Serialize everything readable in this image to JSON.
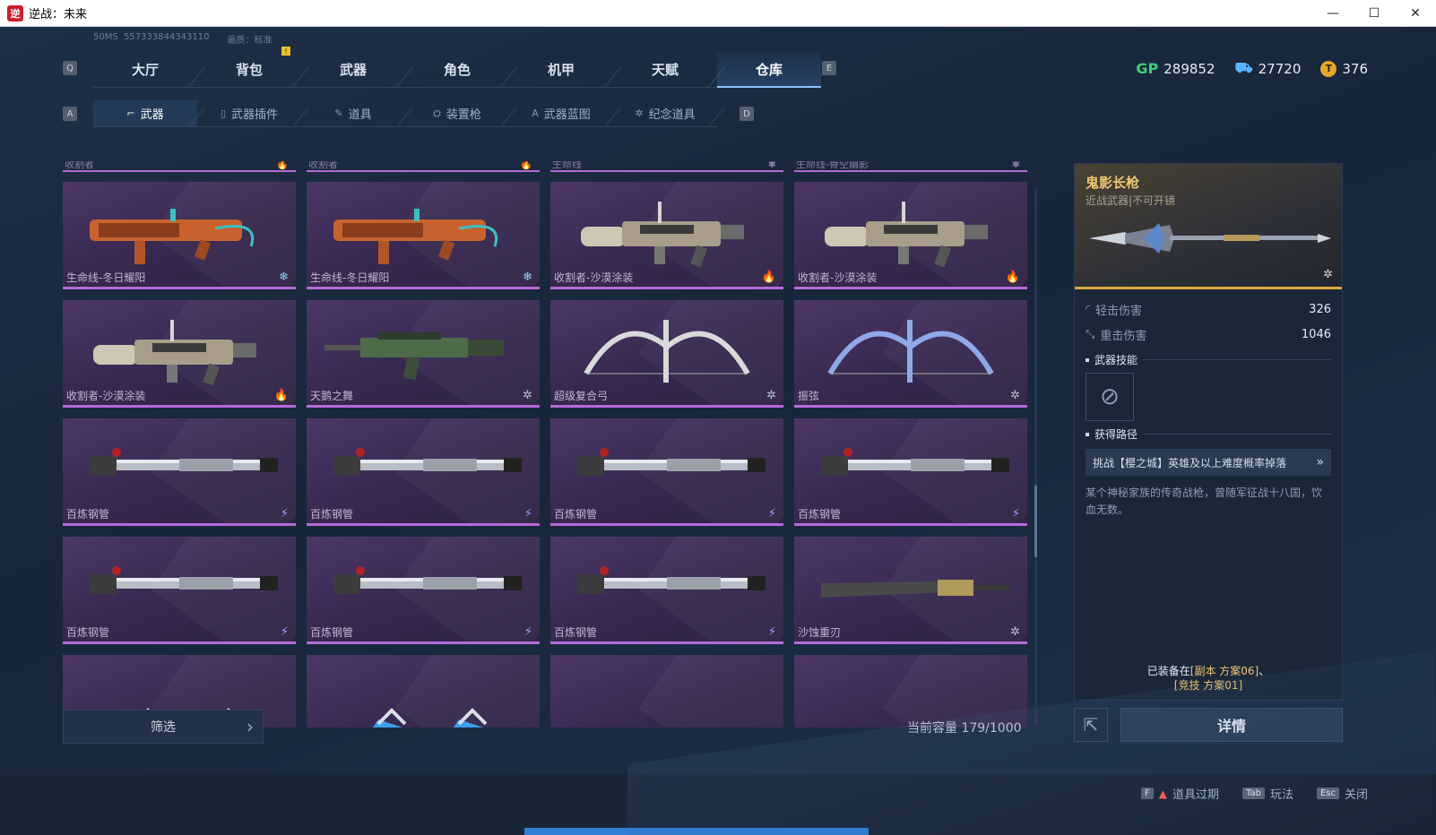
{
  "window": {
    "title": "逆战：未来",
    "controls": [
      "—",
      "☐",
      "✕"
    ]
  },
  "meta": {
    "ping": "50MS",
    "id": "557333844343110",
    "quality": "画质：标准"
  },
  "keys": {
    "prev_tab": "Q",
    "next_tab": "E",
    "prev_sub": "A",
    "next_sub": "D"
  },
  "main_tabs": [
    {
      "label": "大厅"
    },
    {
      "label": "背包"
    },
    {
      "label": "武器"
    },
    {
      "label": "角色"
    },
    {
      "label": "机甲"
    },
    {
      "label": "天赋"
    },
    {
      "label": "仓库"
    }
  ],
  "active_main_tab": "仓库",
  "badge": "!",
  "currency": [
    {
      "icon": "gp-icon",
      "symbol": "GP",
      "value": "289852"
    },
    {
      "icon": "ticket-icon",
      "symbol": "⛟",
      "value": "27720"
    },
    {
      "icon": "coin-icon",
      "symbol": "T",
      "value": "376"
    }
  ],
  "sub_tabs": [
    {
      "label": "武器",
      "icon": "⌐"
    },
    {
      "label": "武器插件",
      "icon": "▯"
    },
    {
      "label": "道具",
      "icon": "✎"
    },
    {
      "label": "装置枪",
      "icon": "⛭"
    },
    {
      "label": "武器蓝图",
      "icon": "A"
    },
    {
      "label": "纪念道具",
      "icon": "✲"
    }
  ],
  "top_strip": [
    {
      "name": "收割者",
      "tag": "🔥"
    },
    {
      "name": "收割者",
      "tag": "🔥"
    },
    {
      "name": "生命线",
      "tag": "✱"
    },
    {
      "name": "生命线-骨空幽影",
      "tag": "✱"
    }
  ],
  "items": [
    {
      "name": "生命线-冬日耀阳",
      "tag": "❄",
      "tag_type": "snow",
      "art": "launcher-orange"
    },
    {
      "name": "生命线-冬日耀阳",
      "tag": "❄",
      "tag_type": "snow",
      "art": "launcher-orange"
    },
    {
      "name": "收割者-沙漠涂装",
      "tag": "🔥",
      "tag_type": "fire",
      "art": "launcher-desert"
    },
    {
      "name": "收割者-沙漠涂装",
      "tag": "🔥",
      "tag_type": "fire",
      "art": "launcher-desert"
    },
    {
      "name": "收割者-沙漠涂装",
      "tag": "🔥",
      "tag_type": "fire",
      "art": "launcher-desert"
    },
    {
      "name": "天鹅之舞",
      "tag": "✲",
      "tag_type": "star",
      "art": "rifle-green"
    },
    {
      "name": "超级复合弓",
      "tag": "✲",
      "tag_type": "star",
      "art": "bow-white"
    },
    {
      "name": "振弦",
      "tag": "✲",
      "tag_type": "star",
      "art": "bow-blue"
    },
    {
      "name": "百炼钢管",
      "tag": "⚡",
      "tag_type": "bolt",
      "art": "pipe"
    },
    {
      "name": "百炼钢管",
      "tag": "⚡",
      "tag_type": "bolt",
      "art": "pipe"
    },
    {
      "name": "百炼钢管",
      "tag": "⚡",
      "tag_type": "bolt",
      "art": "pipe"
    },
    {
      "name": "百炼钢管",
      "tag": "⚡",
      "tag_type": "bolt",
      "art": "pipe"
    },
    {
      "name": "百炼钢管",
      "tag": "⚡",
      "tag_type": "bolt",
      "art": "pipe"
    },
    {
      "name": "百炼钢管",
      "tag": "⚡",
      "tag_type": "bolt",
      "art": "pipe"
    },
    {
      "name": "百炼钢管",
      "tag": "⚡",
      "tag_type": "bolt",
      "art": "pipe"
    },
    {
      "name": "沙蚀重刃",
      "tag": "✲",
      "tag_type": "star",
      "art": "blade"
    },
    {
      "name": "",
      "tag": "",
      "tag_type": "",
      "art": "wings"
    },
    {
      "name": "",
      "tag": "",
      "tag_type": "",
      "art": "wings"
    },
    {
      "name": "",
      "tag": "",
      "tag_type": "",
      "art": "none"
    },
    {
      "name": "",
      "tag": "",
      "tag_type": "",
      "art": "none"
    }
  ],
  "filter": {
    "label": "筛选"
  },
  "capacity": "当前容量 179/1000",
  "detail": {
    "name": "鬼影长枪",
    "subtitle": "近战武器|不可开镜",
    "tag": "✲",
    "stats": [
      {
        "label": "轻击伤害",
        "value": "326"
      },
      {
        "label": "重击伤害",
        "value": "1046"
      }
    ],
    "skill_title": "武器技能",
    "route_title": "获得路径",
    "route": "挑战【樱之城】英雄及以上难度概率掉落",
    "description": "某个神秘家族的传奇战枪，曾随军征战十八国，饮血无数。",
    "equipped_prefix": "已装备在",
    "equipped_a": "[副本 方案06]",
    "equipped_sep": "、",
    "equipped_b": "[竞技 方案01]",
    "details_button": "详情"
  },
  "bottom_hints": [
    {
      "key": "F",
      "label": "道具过期",
      "warn": true
    },
    {
      "key": "Tab",
      "label": "玩法",
      "warn": false
    },
    {
      "key": "Esc",
      "label": "关闭",
      "warn": false
    }
  ],
  "colors": {
    "rarity_purple": "#b56ad9",
    "legendary_gold": "#d8a93f",
    "accent_blue": "#8fc3ff"
  }
}
